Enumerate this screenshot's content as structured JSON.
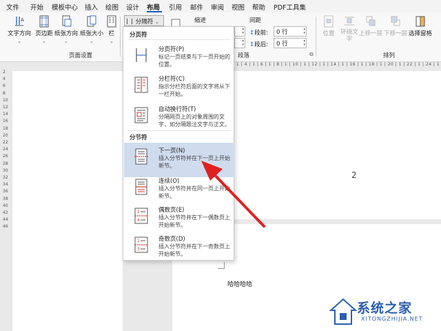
{
  "menubar": {
    "items": [
      {
        "label": "文件"
      },
      {
        "label": "开始"
      },
      {
        "label": "模板中心"
      },
      {
        "label": "插入"
      },
      {
        "label": "绘图"
      },
      {
        "label": "设计"
      },
      {
        "label": "布局"
      },
      {
        "label": "引用"
      },
      {
        "label": "邮件"
      },
      {
        "label": "审阅"
      },
      {
        "label": "视图"
      },
      {
        "label": "帮助"
      },
      {
        "label": "PDF工具集"
      }
    ],
    "active_index": 6
  },
  "ribbon": {
    "page_setup": {
      "text_direction": "文字方向",
      "margins": "页边距",
      "orientation": "纸张方向",
      "size": "纸张大小",
      "columns": "栏",
      "group_label": "页面设置"
    },
    "breaks_button": "分隔符",
    "indent_label": "缩进",
    "spacing_label": "间距",
    "before_label": "段前:",
    "before_value": "0 行",
    "after_label": "段后:",
    "after_value": "0 行",
    "paragraph_group_label": "段落",
    "arrange": {
      "position": "位置",
      "wrap_text": "环绕文字",
      "bring_forward": "上移一层",
      "send_backward": "下移一层",
      "selection_pane": "选择窗格",
      "group_label": "排列"
    }
  },
  "dropdown": {
    "page_breaks_header": "分页符",
    "section_breaks_header": "分节符",
    "items": [
      {
        "title": "分页符(P)",
        "desc": "标记一页结束与下一页开始的位置。"
      },
      {
        "title": "分栏符(C)",
        "desc": "指示分栏符后面的文字将从下一栏开始。"
      },
      {
        "title": "自动换行符(T)",
        "desc": "分隔网页上的对象周围的文字，如分隔题注文字与正文。"
      },
      {
        "title": "下一页(N)",
        "desc": "插入分节符并在下一页上开始新节。"
      },
      {
        "title": "连续(O)",
        "desc": "插入分节符并在同一页上开始新节。"
      },
      {
        "title": "偶数页(E)",
        "desc": "插入分节符并在下一偶数页上开始新节。"
      },
      {
        "title": "奇数页(D)",
        "desc": "插入分节符并在下一奇数页上开始新节。"
      }
    ],
    "highlighted_index": 3
  },
  "document": {
    "page_number": "2",
    "body_text": "哈哈哈哈",
    "top_ruler": "| 1 | 4 | 1 | 6 | 1 | 8 | 1 | 10 | 1 | 12 | 1 | 14 | 1 | 16 | 1 | 18 | 1 | 20 | 1 | 22 | 1 | 24 | 1 | 26 |",
    "left_ruler": [
      "2",
      "4",
      "6",
      "8",
      "10",
      "12",
      "14",
      "16",
      "18",
      "20",
      "22",
      "24",
      "26",
      "28",
      "30",
      "32",
      "34",
      "36",
      "38",
      "40",
      "42",
      "44",
      "46"
    ]
  },
  "watermark": {
    "brand": "系统之家",
    "url": "XITONGZHIJIA.NET"
  },
  "colors": {
    "accent": "#185abd",
    "highlight": "#cfdcee",
    "arrow": "#e02020",
    "icon_red": "#d23a2a"
  }
}
